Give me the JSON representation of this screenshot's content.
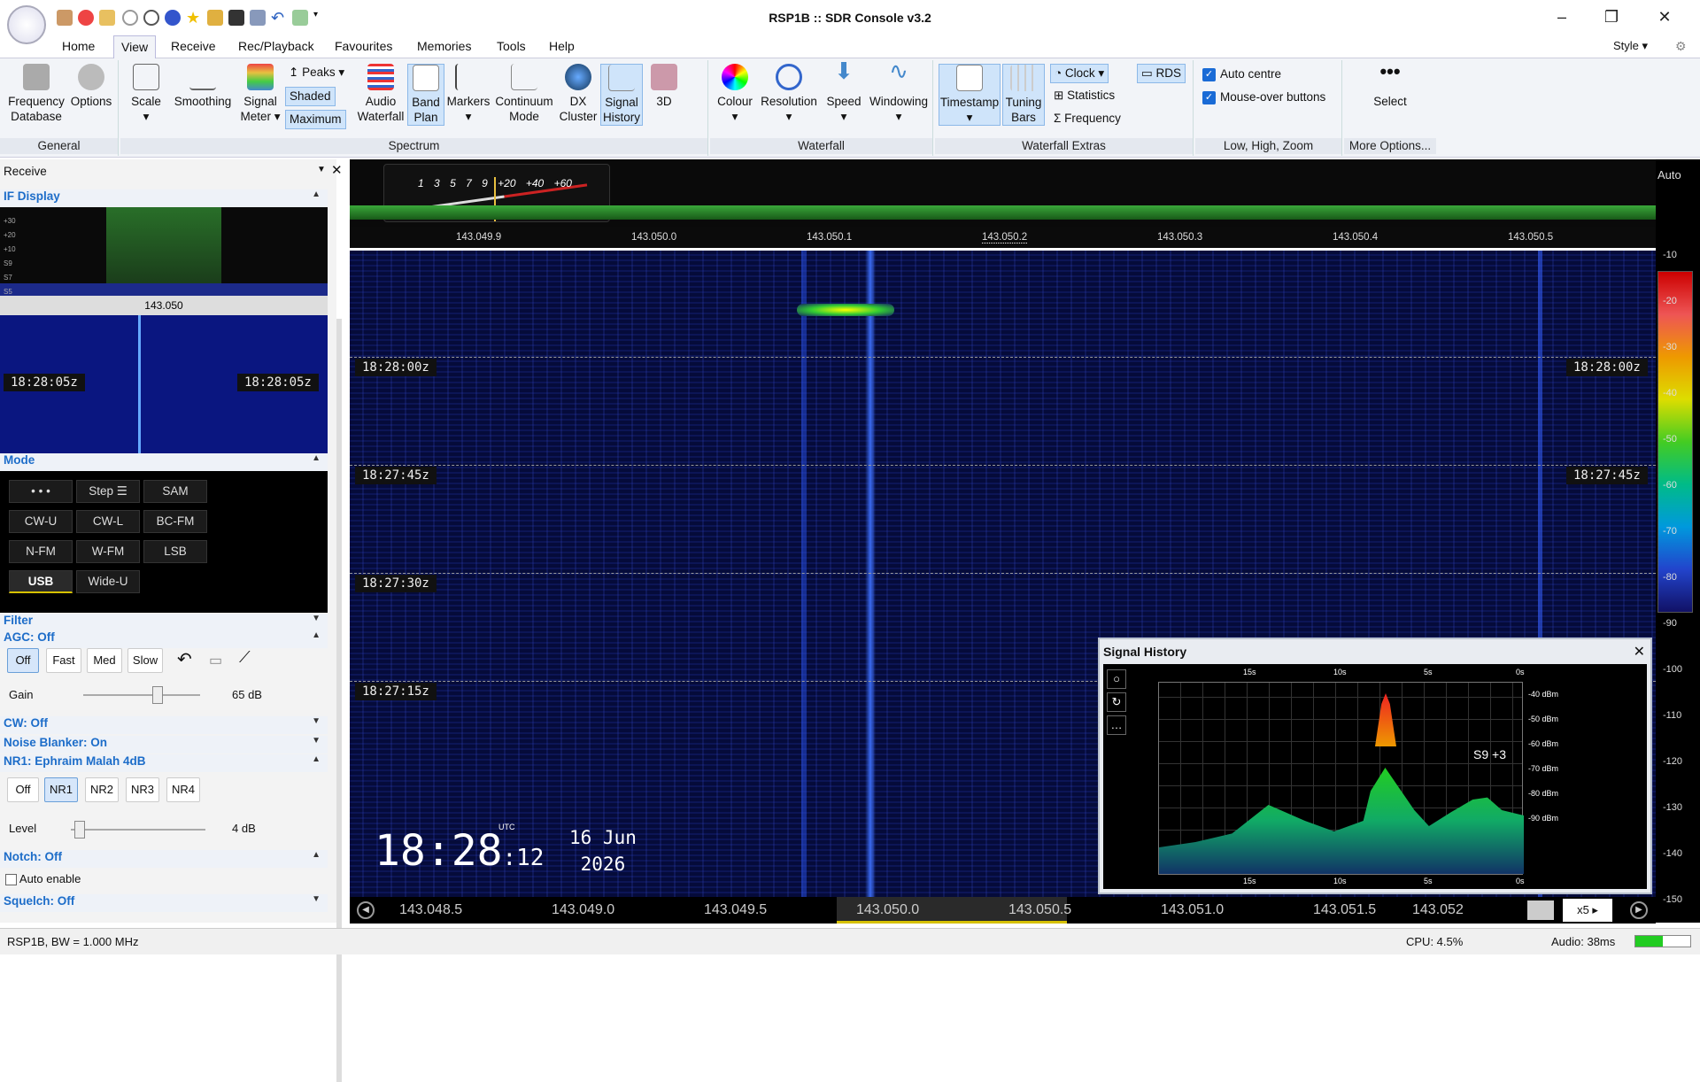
{
  "app": {
    "title": "RSP1B :: SDR Console v3.2"
  },
  "menu": [
    "Home",
    "View",
    "Receive",
    "Rec/Playback",
    "Favourites",
    "Memories",
    "Tools",
    "Help"
  ],
  "menu_active": "View",
  "style_label": "Style",
  "ribbon": {
    "general": {
      "label": "General",
      "freqdb": "Frequency Database",
      "options": "Options"
    },
    "spectrum": {
      "label": "Spectrum",
      "scale": "Scale",
      "smoothing": "Smoothing",
      "signal_meter": "Signal Meter",
      "peaks": "Peaks",
      "shaded": "Shaded",
      "maximum": "Maximum",
      "audio_waterfall": "Audio Waterfall",
      "band_plan": "Band Plan",
      "markers": "Markers",
      "continuum": "Continuum Mode",
      "dx": "DX Cluster",
      "signal_history": "Signal History",
      "three_d": "3D"
    },
    "waterfall": {
      "label": "Waterfall",
      "colour": "Colour",
      "resolution": "Resolution",
      "speed": "Speed",
      "windowing": "Windowing"
    },
    "extras": {
      "label": "Waterfall Extras",
      "timestamp": "Timestamp",
      "tuning": "Tuning Bars",
      "clock": "Clock",
      "statistics": "Statistics",
      "frequency": "Frequency",
      "rds": "RDS"
    },
    "low": {
      "label": "Low, High, Zoom",
      "auto_centre": "Auto centre",
      "mouse_over": "Mouse-over buttons"
    },
    "more": {
      "label": "More Options...",
      "select": "Select"
    }
  },
  "left": {
    "receive": "Receive",
    "if_display": "IF Display",
    "if_levels": [
      "+30",
      "+20",
      "+10",
      "S9",
      "S7",
      "S5"
    ],
    "if_freq": "143.050",
    "if_time": "18:28:05z",
    "mode": "Mode",
    "modes": [
      "• • •",
      "Step ☰",
      "SAM",
      "CW-U",
      "CW-L",
      "BC-FM",
      "N-FM",
      "W-FM",
      "LSB",
      "USB",
      "Wide-U"
    ],
    "mode_active": "USB",
    "filter": "Filter",
    "agc": "AGC: Off",
    "agc_buttons": [
      "Off",
      "Fast",
      "Med",
      "Slow"
    ],
    "gain_label": "Gain",
    "gain_value": "65 dB",
    "cw": "CW: Off",
    "nb": "Noise Blanker: On",
    "nr": "NR1: Ephraim Malah 4dB",
    "nr_buttons": [
      "Off",
      "NR1",
      "NR2",
      "NR3",
      "NR4"
    ],
    "level_label": "Level",
    "level_value": "4 dB",
    "notch": "Notch: Off",
    "auto_enable": "Auto enable",
    "squelch": "Squelch: Off"
  },
  "spectrum": {
    "meter_scale": [
      "1",
      "3",
      "5",
      "7",
      "9",
      "+20",
      "+40",
      "+60"
    ],
    "freqs": [
      "143.049.9",
      "143.050.0",
      "143.050.1",
      "143.050.2",
      "143.050.3",
      "143.050.4",
      "143.050.5"
    ]
  },
  "waterfall": {
    "timestamps": [
      "18:28:00z",
      "18:27:45z",
      "18:27:30z",
      "18:27:15z"
    ],
    "clock_time": "18:28",
    "clock_sec": "12",
    "clock_utc": "UTC",
    "date_line1": "16 Jun",
    "date_line2": "2026"
  },
  "bottom_freqs": [
    "143.048.5",
    "143.049.0",
    "143.049.5",
    "143.050.0",
    "143.050.5",
    "143.051.0",
    "143.051.5",
    "143.052"
  ],
  "zoom": "x5",
  "db_scale": {
    "auto": "Auto",
    "labels": [
      "-10",
      "-20",
      "-30",
      "-40",
      "-50",
      "-60",
      "-70",
      "-80",
      "-90",
      "-100",
      "-110",
      "-120",
      "-130",
      "-140",
      "-150"
    ]
  },
  "signal_history": {
    "title": "Signal History",
    "x_labels": [
      "15s",
      "10s",
      "5s",
      "0s"
    ],
    "y_labels": [
      "-40 dBm",
      "-50 dBm",
      "-60 dBm",
      "-70 dBm",
      "-80 dBm",
      "-90 dBm"
    ],
    "reading": "S9 +3"
  },
  "status": {
    "left": "RSP1B, BW = 1.000 MHz",
    "cpu": "CPU: 4.5%",
    "audio": "Audio: 38ms"
  }
}
